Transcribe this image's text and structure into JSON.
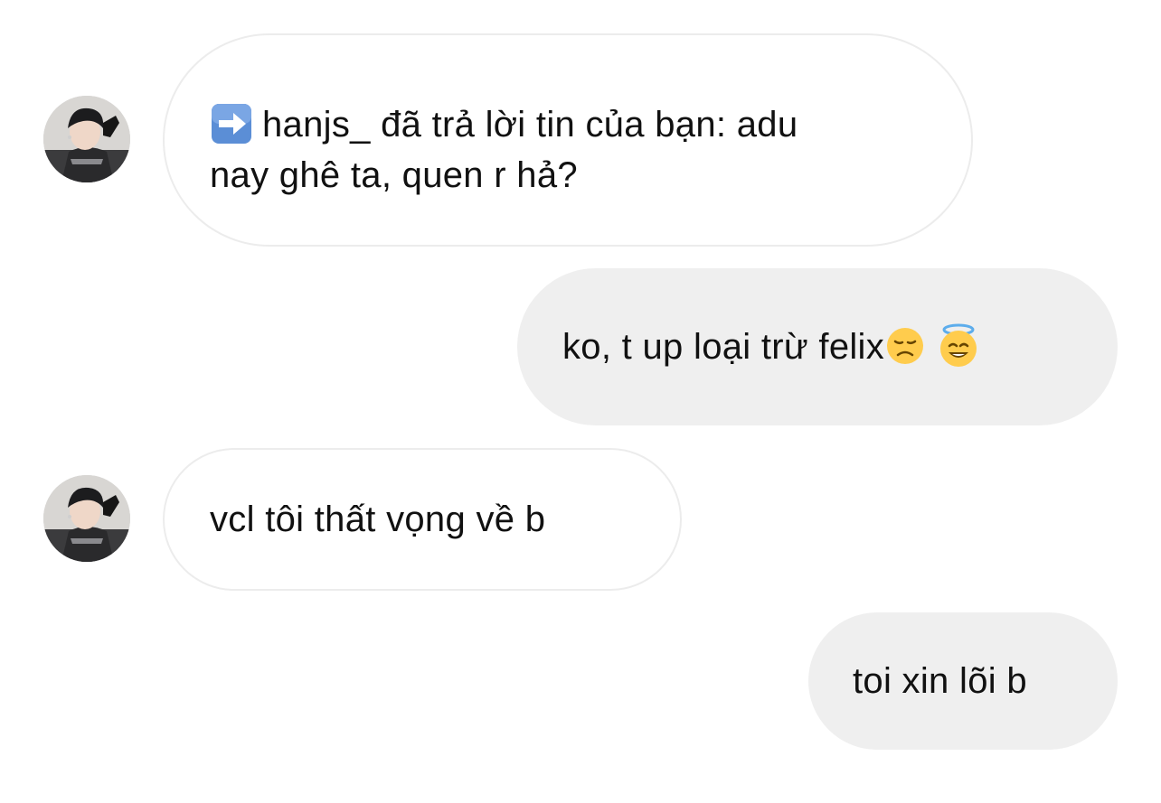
{
  "messages": [
    {
      "sender": "other",
      "prefix_icon": "arrow-right-icon",
      "text_line1": "hanjs_ đã trả lời tin của bạn: adu",
      "text_line2": "nay ghê ta, quen r hả?"
    },
    {
      "sender": "me",
      "text": "ko, t up loại trừ felix",
      "emojis": [
        "disappointed-face-icon",
        "smiling-face-with-halo-icon"
      ]
    },
    {
      "sender": "other",
      "text": "vcl tôi thất vọng về b"
    },
    {
      "sender": "me",
      "text": "toi xin lõi b"
    }
  ],
  "colors": {
    "incoming_bubble_bg": "#ffffff",
    "incoming_bubble_border": "#ececec",
    "outgoing_bubble_bg": "#efefef",
    "text": "#111111",
    "arrow_icon_bg": "#5b8ed6"
  }
}
